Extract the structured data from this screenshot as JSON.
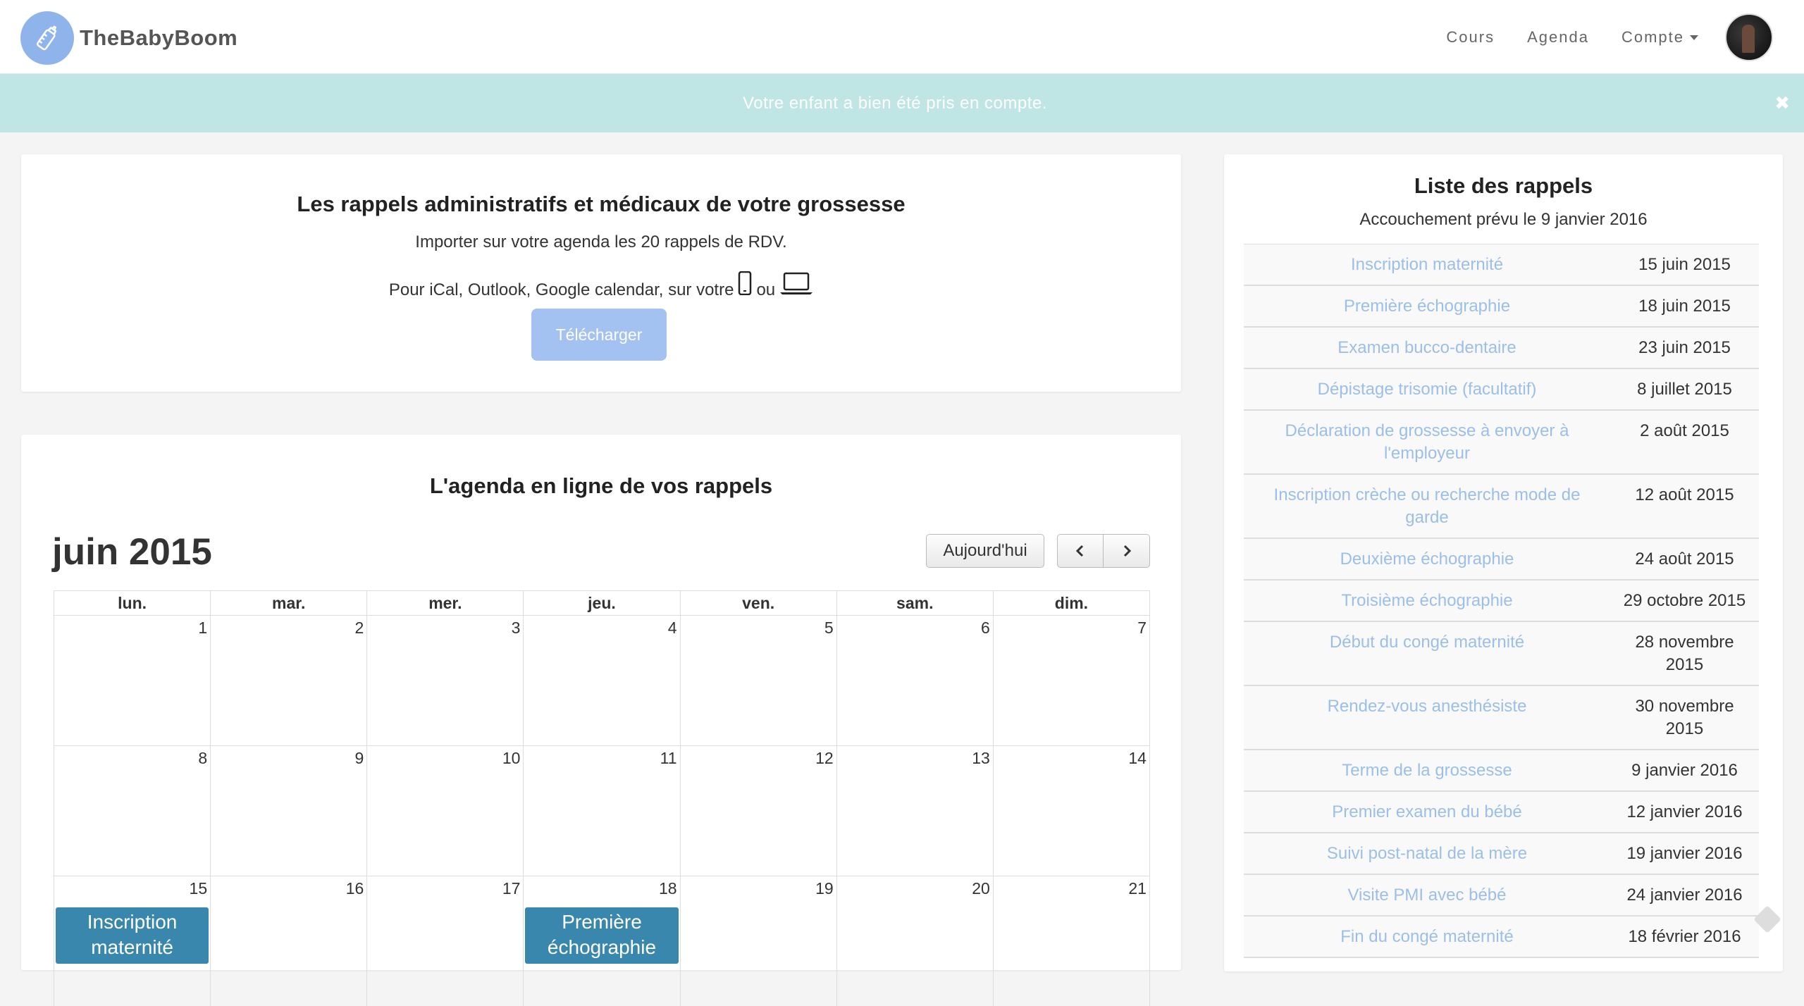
{
  "brand": {
    "name": "TheBabyBoom"
  },
  "nav": {
    "cours": "Cours",
    "agenda": "Agenda",
    "compte": "Compte"
  },
  "alert": {
    "message": "Votre enfant a bien été pris en compte.",
    "close": "✖"
  },
  "reminders_panel": {
    "title": "Les rappels administratifs et médicaux de votre grossesse",
    "subtitle": "Importer sur votre agenda les 20 rappels de RDV.",
    "line_prefix": "Pour iCal, Outlook, Google calendar, sur votre",
    "line_or": "ou",
    "download_label": "Télécharger"
  },
  "calendar": {
    "title": "L'agenda en ligne de vos rappels",
    "month": "juin 2015",
    "today_label": "Aujourd'hui",
    "weekdays": [
      "lun.",
      "mar.",
      "mer.",
      "jeu.",
      "ven.",
      "sam.",
      "dim."
    ],
    "weeks": [
      [
        {
          "d": "1"
        },
        {
          "d": "2"
        },
        {
          "d": "3"
        },
        {
          "d": "4"
        },
        {
          "d": "5"
        },
        {
          "d": "6"
        },
        {
          "d": "7"
        }
      ],
      [
        {
          "d": "8"
        },
        {
          "d": "9"
        },
        {
          "d": "10"
        },
        {
          "d": "11"
        },
        {
          "d": "12"
        },
        {
          "d": "13"
        },
        {
          "d": "14"
        }
      ],
      [
        {
          "d": "15",
          "event": "Inscription maternité"
        },
        {
          "d": "16"
        },
        {
          "d": "17"
        },
        {
          "d": "18",
          "event": "Première échographie"
        },
        {
          "d": "19"
        },
        {
          "d": "20"
        },
        {
          "d": "21"
        }
      ]
    ]
  },
  "list_panel": {
    "title": "Liste des rappels",
    "subtitle": "Accouchement prévu le 9 janvier 2016",
    "rows": [
      {
        "name": "Inscription maternité",
        "date": "15 juin 2015"
      },
      {
        "name": "Première échographie",
        "date": "18 juin 2015"
      },
      {
        "name": "Examen bucco-dentaire",
        "date": "23 juin 2015"
      },
      {
        "name": "Dépistage trisomie (facultatif)",
        "date": "8 juillet 2015"
      },
      {
        "name": "Déclaration de grossesse à envoyer à l'employeur",
        "date": "2 août 2015"
      },
      {
        "name": "Inscription crèche ou recherche mode de garde",
        "date": "12 août 2015"
      },
      {
        "name": "Deuxième échographie",
        "date": "24 août 2015"
      },
      {
        "name": "Troisième échographie",
        "date": "29 octobre 2015"
      },
      {
        "name": "Début du congé maternité",
        "date": "28 novembre 2015"
      },
      {
        "name": "Rendez-vous anesthésiste",
        "date": "30 novembre 2015"
      },
      {
        "name": "Terme de la grossesse",
        "date": "9 janvier 2016"
      },
      {
        "name": "Premier examen du bébé",
        "date": "12 janvier 2016"
      },
      {
        "name": "Suivi post-natal de la mère",
        "date": "19 janvier 2016"
      },
      {
        "name": "Visite PMI avec bébé",
        "date": "24 janvier 2016"
      },
      {
        "name": "Fin du congé maternité",
        "date": "18 février 2016"
      }
    ]
  },
  "colors": {
    "brand": "#8fb4ec",
    "alert_bg": "#bfe6e5",
    "event": "#3a87ad",
    "link": "#9bbfe9",
    "button": "#a3c1f1"
  },
  "icons": {
    "logo": "baby-bottle-icon",
    "phone": "phone-icon",
    "laptop": "laptop-icon"
  }
}
